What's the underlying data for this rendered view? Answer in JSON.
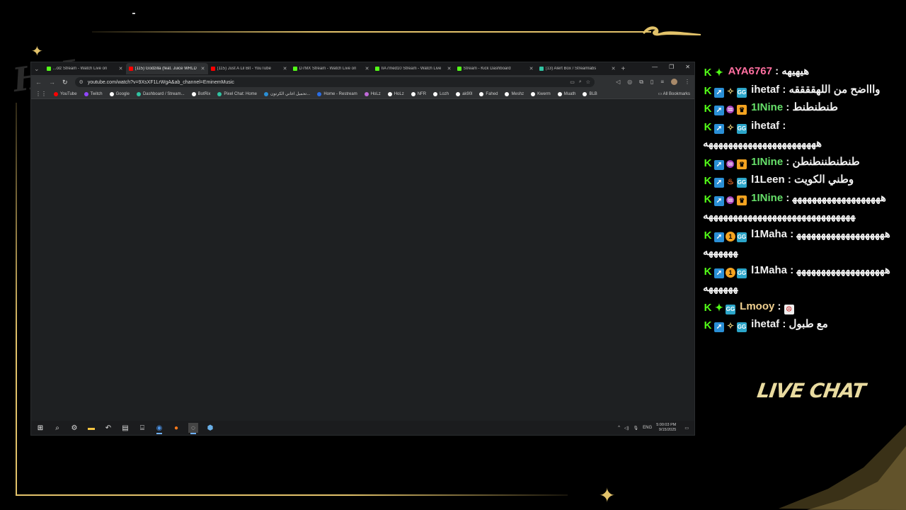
{
  "browser": {
    "tabs": [
      {
        "title": "...olz Stream - Watch Live on",
        "color": "#53fc18",
        "active": false
      },
      {
        "title": "(115) Godzilla (feat. Juice WRLD",
        "color": "#ff0000",
        "active": true
      },
      {
        "title": "(115) Just A Lil Bit - YouTube",
        "color": "#ff0000",
        "active": false
      },
      {
        "title": "D7MX Stream - Watch Live on",
        "color": "#53fc18",
        "active": false
      },
      {
        "title": "IIA7med10 Stream - Watch Live",
        "color": "#53fc18",
        "active": false
      },
      {
        "title": "Stream - Kick Dashboard",
        "color": "#53fc18",
        "active": false
      },
      {
        "title": "(13) Alert Box / Streamlabs",
        "color": "#31c3a2",
        "active": false
      }
    ],
    "url": "youtube.com/watch?v=9XsXF1LrWgA&ab_channel=EminemMusic",
    "bookmarks": [
      {
        "label": "YouTube",
        "color": "#ff0000"
      },
      {
        "label": "Twitch",
        "color": "#9146ff"
      },
      {
        "label": "Google",
        "color": "#ffffff"
      },
      {
        "label": "Dashboard / Stream...",
        "color": "#31c3a2"
      },
      {
        "label": "BotRix",
        "color": "#ffffff"
      },
      {
        "label": "Pixel Chat: Home",
        "color": "#31c3a2"
      },
      {
        "label": "تحميل اغاني الكرتون...",
        "color": "#2a8fd6"
      },
      {
        "label": "Home - Restream",
        "color": "#2a6ee6"
      },
      {
        "label": "HoLz",
        "color": "#ffffff"
      },
      {
        "label": "HoLz",
        "color": "#ffffff"
      },
      {
        "label": "NFR",
        "color": "#ffffff"
      },
      {
        "label": "Lozh",
        "color": "#ffffff"
      },
      {
        "label": "ak90l",
        "color": "#ffffff"
      },
      {
        "label": "Fahed",
        "color": "#ffffff"
      },
      {
        "label": "Meshz",
        "color": "#ffffff"
      },
      {
        "label": "Kwerm",
        "color": "#ffffff"
      },
      {
        "label": "Muath",
        "color": "#ffffff"
      },
      {
        "label": "BLB",
        "color": "#ffffff"
      }
    ],
    "all_bookmarks": "All Bookmarks"
  },
  "taskbar": {
    "language": "ENG",
    "time": "5:00:03 PM",
    "date": "9/15/2025"
  },
  "chat": {
    "messages": [
      {
        "badges": [
          "k",
          "dia"
        ],
        "user": "AYA6767",
        "color": "#ff6fa0",
        "text": "هيهيهه"
      },
      {
        "badges": [
          "k",
          "arrow",
          "star",
          "gg"
        ],
        "user": "ihetaf",
        "color": "#ffffff",
        "text": "واااضح من اللهققققه"
      },
      {
        "badges": [
          "k",
          "arrow",
          "wave",
          "crown"
        ],
        "user": "1INine",
        "color": "#66e06a",
        "text": "طنطنطنط"
      },
      {
        "badges": [
          "k",
          "arrow",
          "star",
          "gg"
        ],
        "user": "ihetaf",
        "color": "#ffffff",
        "text": "هههههههههههههههههههههههه"
      },
      {
        "badges": [
          "k",
          "arrow",
          "wave",
          "crown"
        ],
        "user": "1INine",
        "color": "#66e06a",
        "text": "طنطنطننطنطن"
      },
      {
        "badges": [
          "k",
          "arrow",
          "flame",
          "gg"
        ],
        "user": "l1Leen",
        "color": "#ffffff",
        "text": "وطني الكويت"
      },
      {
        "badges": [
          "k",
          "arrow",
          "wave",
          "crown"
        ],
        "user": "1INine",
        "color": "#66e06a",
        "text": "هههههههههههههههههههههههههههههههههههههههههههههههههه"
      },
      {
        "badges": [
          "k",
          "arrow",
          "one",
          "gg"
        ],
        "user": "l1Maha",
        "color": "#ffffff",
        "text": "هههههههههههههههههههههههههه"
      },
      {
        "badges": [
          "k",
          "arrow",
          "one",
          "gg"
        ],
        "user": "l1Maha",
        "color": "#ffffff",
        "text": "هههههههههههههههههههههههههه"
      },
      {
        "badges": [
          "k",
          "dia",
          "gg"
        ],
        "user": "Lmooy",
        "color": "#f0d090",
        "text": "",
        "emote": true
      },
      {
        "badges": [
          "k",
          "arrow",
          "star",
          "gg"
        ],
        "user": "ihetaf",
        "color": "#ffffff",
        "text": "مع طبول"
      }
    ],
    "title": "LIVE CHAT"
  },
  "overlay": {
    "accent": "#e2c26a",
    "logo_text": "HoLz"
  }
}
